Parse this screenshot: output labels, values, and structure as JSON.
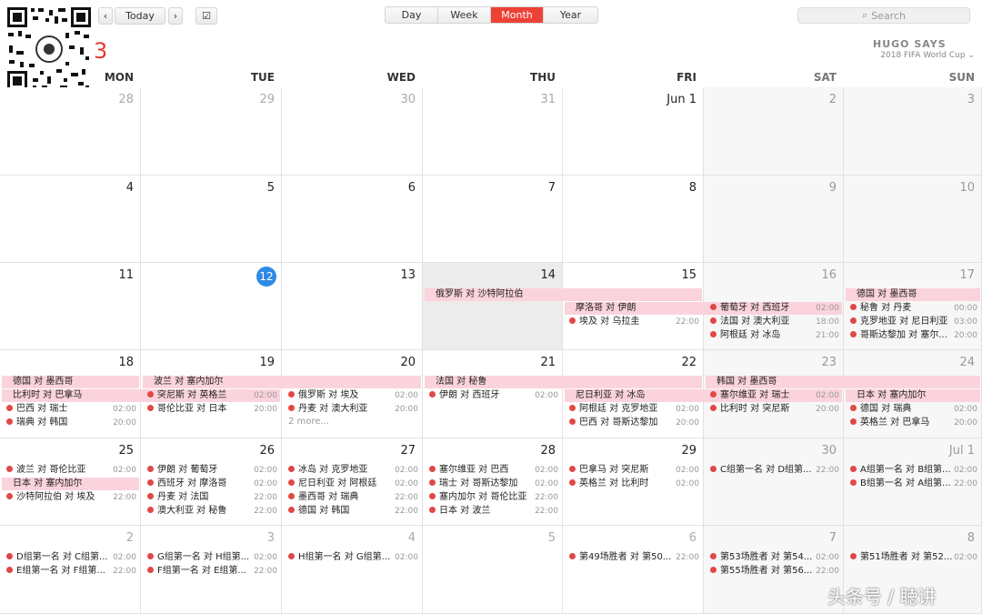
{
  "toolbar": {
    "today_label": "Today",
    "prev_icon": "chevron-left-icon",
    "next_icon": "chevron-right-icon",
    "add_icon": "calendar-check-icon",
    "views": [
      "Day",
      "Week",
      "Month",
      "Year"
    ],
    "active_view": "Month",
    "search_placeholder": "Search"
  },
  "header": {
    "month_title_visible": "3",
    "logo_line1": "HUGO SAYS",
    "logo_line2": "2018 FIFA World Cup"
  },
  "weekdays": [
    "MON",
    "TUE",
    "WED",
    "THU",
    "FRI",
    "SAT",
    "SUN"
  ],
  "weeks": [
    {
      "days": [
        "28",
        "29",
        "30",
        "31",
        "Jun 1",
        "2",
        "3"
      ]
    },
    {
      "days": [
        "4",
        "5",
        "6",
        "7",
        "8",
        "9",
        "10"
      ]
    },
    {
      "days": [
        "11",
        "12",
        "13",
        "14",
        "15",
        "16",
        "17"
      ]
    },
    {
      "days": [
        "18",
        "19",
        "20",
        "21",
        "22",
        "23",
        "24"
      ]
    },
    {
      "days": [
        "25",
        "26",
        "27",
        "28",
        "29",
        "30",
        "Jul 1"
      ]
    },
    {
      "days": [
        "2",
        "3",
        "4",
        "5",
        "6",
        "7",
        "8"
      ]
    }
  ],
  "today": "12",
  "banners": {
    "w3": [
      "俄罗斯 对 沙特阿拉伯",
      "摩洛哥 对 伊朗",
      "德国 对 墨西哥"
    ],
    "w4": [
      "德国 对 墨西哥",
      "比利时 对 巴拿马",
      "波兰 对 塞内加尔",
      "法国 对 秘鲁",
      "尼日利亚 对 冰岛",
      "韩国 对 墨西哥",
      "日本 对 塞内加尔"
    ],
    "w5": [
      "日本 对 塞内加尔"
    ]
  },
  "events": {
    "w3": {
      "fri": [
        {
          "name": "埃及 对 乌拉圭",
          "time": "22:00"
        }
      ],
      "sat": [
        {
          "name": "葡萄牙 对 西班牙",
          "time": "02:00"
        },
        {
          "name": "法国 对 澳大利亚",
          "time": "18:00"
        },
        {
          "name": "阿根廷 对 冰岛",
          "time": "21:00"
        }
      ],
      "sun": [
        {
          "name": "秘鲁 对 丹麦",
          "time": "00:00"
        },
        {
          "name": "克罗地亚 对 尼日利亚",
          "time": "03:00"
        },
        {
          "name": "哥斯达黎加 对 塞尔...",
          "time": "20:00"
        }
      ]
    },
    "w4": {
      "mon": [
        {
          "name": "巴西 对 瑞士",
          "time": "02:00"
        },
        {
          "name": "瑞典 对 韩国",
          "time": "20:00"
        }
      ],
      "tue": [
        {
          "name": "突尼斯 对 英格兰",
          "time": "02:00"
        },
        {
          "name": "哥伦比亚 对 日本",
          "time": "20:00"
        }
      ],
      "wed": [
        {
          "name": "俄罗斯 对 埃及",
          "time": "02:00"
        },
        {
          "name": "丹麦 对 澳大利亚",
          "time": "20:00"
        }
      ],
      "wed_more": "2 more...",
      "thu": [
        {
          "name": "伊朗 对 西班牙",
          "time": "02:00"
        }
      ],
      "fri": [
        {
          "name": "阿根廷 对 克罗地亚",
          "time": "02:00"
        },
        {
          "name": "巴西 对 哥斯达黎加",
          "time": "20:00"
        }
      ],
      "sat": [
        {
          "name": "塞尔维亚 对 瑞士",
          "time": "02:00"
        },
        {
          "name": "比利时 对 突尼斯",
          "time": "20:00"
        }
      ],
      "sun": [
        {
          "name": "德国 对 瑞典",
          "time": "02:00"
        },
        {
          "name": "英格兰 对 巴拿马",
          "time": "20:00"
        }
      ]
    },
    "w5": {
      "mon": [
        {
          "name": "波兰 对 哥伦比亚",
          "time": "02:00"
        },
        {
          "name": "沙特阿拉伯 对 埃及",
          "time": "22:00"
        }
      ],
      "tue": [
        {
          "name": "伊朗 对 葡萄牙",
          "time": "02:00"
        },
        {
          "name": "西班牙 对 摩洛哥",
          "time": "02:00"
        },
        {
          "name": "丹麦 对 法国",
          "time": "22:00"
        },
        {
          "name": "澳大利亚 对 秘鲁",
          "time": "22:00"
        }
      ],
      "wed": [
        {
          "name": "冰岛 对 克罗地亚",
          "time": "02:00"
        },
        {
          "name": "尼日利亚 对 阿根廷",
          "time": "02:00"
        },
        {
          "name": "墨西哥 对 瑞典",
          "time": "22:00"
        },
        {
          "name": "德国 对 韩国",
          "time": "22:00"
        }
      ],
      "thu": [
        {
          "name": "塞尔维亚 对 巴西",
          "time": "02:00"
        },
        {
          "name": "瑞士 对 哥斯达黎加",
          "time": "02:00"
        },
        {
          "name": "塞内加尔 对 哥伦比亚",
          "time": "22:00"
        },
        {
          "name": "日本 对 波兰",
          "time": "22:00"
        }
      ],
      "fri": [
        {
          "name": "巴拿马 对 突尼斯",
          "time": "02:00"
        },
        {
          "name": "英格兰 对 比利时",
          "time": "02:00"
        }
      ],
      "sat": [
        {
          "name": "C组第一名 对 D组第...",
          "time": "22:00"
        }
      ],
      "sun": [
        {
          "name": "A组第一名 对 B组第...",
          "time": "02:00"
        },
        {
          "name": "B组第一名 对 A组第...",
          "time": "22:00"
        }
      ]
    },
    "w6": {
      "mon": [
        {
          "name": "D组第一名 对 C组第...",
          "time": "02:00"
        },
        {
          "name": "E组第一名 对 F组第...",
          "time": "22:00"
        }
      ],
      "tue": [
        {
          "name": "G组第一名 对 H组第...",
          "time": "02:00"
        },
        {
          "name": "F组第一名 对 E组第...",
          "time": "22:00"
        }
      ],
      "wed": [
        {
          "name": "H组第一名 对 G组第...",
          "time": "02:00"
        }
      ],
      "fri": [
        {
          "name": "第49场胜者 对 第50...",
          "time": "22:00"
        }
      ],
      "sat": [
        {
          "name": "第53场胜者 对 第54...",
          "time": "02:00"
        },
        {
          "name": "第55场胜者 对 第56...",
          "time": "22:00"
        }
      ],
      "sun": [
        {
          "name": "第51场胜者 对 第52...",
          "time": "02:00"
        }
      ]
    }
  },
  "watermark": "头条号 / 聴讲",
  "colors": {
    "accent": "#ec4236",
    "today": "#2f8ae5",
    "event_dot": "#e04845",
    "banner": "#fbd3dc"
  }
}
